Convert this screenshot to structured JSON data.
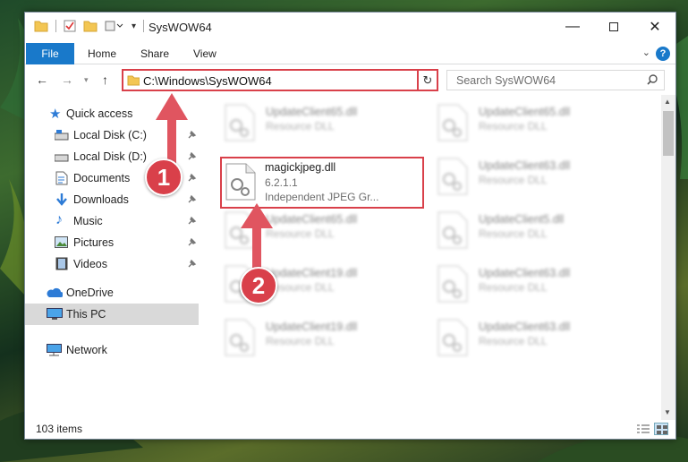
{
  "window": {
    "title": "SysWOW64"
  },
  "ribbon": {
    "tabs": [
      "File",
      "Home",
      "Share",
      "View"
    ],
    "help": "?"
  },
  "address": {
    "path": "C:\\Windows\\SysWOW64",
    "search_placeholder": "Search SysWOW64"
  },
  "sidebar": {
    "items": [
      {
        "label": "Quick access",
        "icon": "star-icon",
        "pinned": false
      },
      {
        "label": "Local Disk (C:)",
        "icon": "drive-icon",
        "pinned": true
      },
      {
        "label": "Local Disk (D:)",
        "icon": "drive-icon",
        "pinned": true
      },
      {
        "label": "Documents",
        "icon": "documents-icon",
        "pinned": true
      },
      {
        "label": "Downloads",
        "icon": "download-icon",
        "pinned": true
      },
      {
        "label": "Music",
        "icon": "music-icon",
        "pinned": true
      },
      {
        "label": "Pictures",
        "icon": "pictures-icon",
        "pinned": true
      },
      {
        "label": "Videos",
        "icon": "videos-icon",
        "pinned": true
      },
      {
        "label": "OneDrive",
        "icon": "onedrive-icon",
        "pinned": false
      },
      {
        "label": "This PC",
        "icon": "pc-icon",
        "pinned": false
      },
      {
        "label": "Network",
        "icon": "network-icon",
        "pinned": false
      }
    ]
  },
  "files": {
    "highlighted": {
      "name": "magickjpeg.dll",
      "version": "6.2.1.1",
      "description": "Independent JPEG Gr..."
    },
    "background": [
      {
        "name": "UpdateClient65.dll",
        "type": "Resource DLL"
      },
      {
        "name": "UpdateClient65.dll",
        "type": "Resource DLL"
      },
      {
        "name": "UpdateClient63.dll",
        "type": "Resource DLL"
      },
      {
        "name": "UpdateClient65.dll",
        "type": "Resource DLL"
      },
      {
        "name": "UpdateClient5.dll",
        "type": "Resource DLL"
      },
      {
        "name": "UpdateClient19.dll",
        "type": "Resource DLL"
      },
      {
        "name": "UpdateClient63.dll",
        "type": "Resource DLL"
      },
      {
        "name": "UpdateClient19.dll",
        "type": "Resource DLL"
      },
      {
        "name": "UpdateClient63.dll",
        "type": "Resource DLL"
      }
    ]
  },
  "status": {
    "item_count": "103 items"
  },
  "callouts": [
    "1",
    "2"
  ],
  "colors": {
    "accent": "#1979ca",
    "highlight": "#d9404a"
  }
}
